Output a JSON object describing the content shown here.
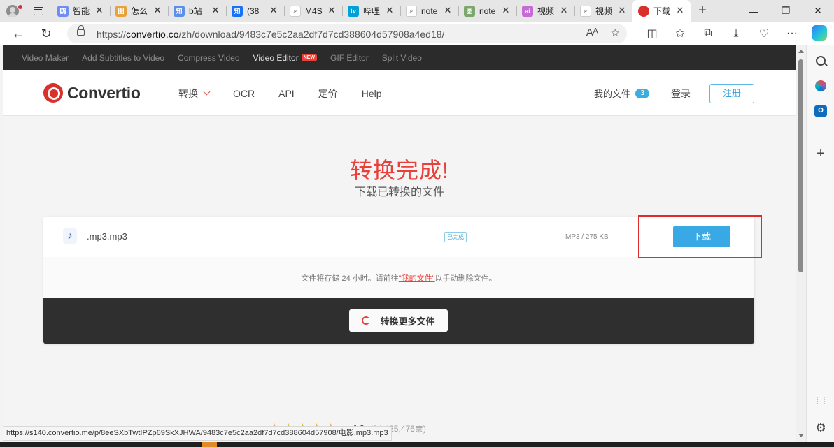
{
  "browser": {
    "tabs": [
      {
        "label": "智能",
        "fav_color": "#6d8df3",
        "fav_glyph": "鸥"
      },
      {
        "label": "怎么",
        "fav_color": "#e6a23c",
        "fav_glyph": "图"
      },
      {
        "label": "b站",
        "fav_color": "#5b8fe8",
        "fav_glyph": "知"
      },
      {
        "label": "(38",
        "fav_color": "#1772f6",
        "fav_glyph": "知"
      },
      {
        "label": "M4S",
        "fav_color": "#9aa0a6",
        "fav_glyph": "🔍"
      },
      {
        "label": "哔哩",
        "fav_color": "#00a1d6",
        "fav_glyph": "tv"
      },
      {
        "label": "note",
        "fav_color": "#9aa0a6",
        "fav_glyph": "🔍"
      },
      {
        "label": "note",
        "fav_color": "#7aa86a",
        "fav_glyph": "图"
      },
      {
        "label": "视频",
        "fav_color": "#c46bd6",
        "fav_glyph": "ai"
      },
      {
        "label": "视频",
        "fav_color": "#9aa0a6",
        "fav_glyph": "🔍"
      },
      {
        "label": "下载",
        "fav_color": "#d9302b",
        "fav_glyph": "C"
      }
    ],
    "url_prefix": "https://",
    "url_domain": "convertio.co",
    "url_path": "/zh/download/9483c7e5c2aa2df7d7cd388604d57908a4ed18/",
    "status_url": "https://s140.convertio.me/p/8eeSXbTwtIPZp69SkXJHWA/9483c7e5c2aa2df7d7cd388604d57908/电影.mp3.mp3"
  },
  "topstrip": {
    "items": [
      "Video Maker",
      "Add Subtitles to Video",
      "Compress Video",
      "Video Editor",
      "GIF Editor",
      "Split Video"
    ],
    "new_badge": "NEW"
  },
  "header": {
    "logo": "Convertio",
    "nav": [
      "转换",
      "OCR",
      "API",
      "定价",
      "Help"
    ],
    "my_files": "我的文件",
    "file_count": "3",
    "login": "登录",
    "register": "注册"
  },
  "main": {
    "title": "转换完成!",
    "subtitle": "下载已转换的文件",
    "file": {
      "name": ".mp3.mp3",
      "status": "已完成",
      "size": "MP3 / 275 KB",
      "download": "下载"
    },
    "storage_note_before": "文件将存储 24 小时。请前往",
    "storage_note_link": "\"我的文件\"",
    "storage_note_after": "以手动删除文件。",
    "more_button": "转换更多文件"
  },
  "rating": {
    "score": "4.6",
    "votes": "(24,425,476票)"
  },
  "colors": {
    "brand_red": "#e8403a",
    "accent_blue": "#38a9e4",
    "highlight_red": "#e22a2a"
  }
}
